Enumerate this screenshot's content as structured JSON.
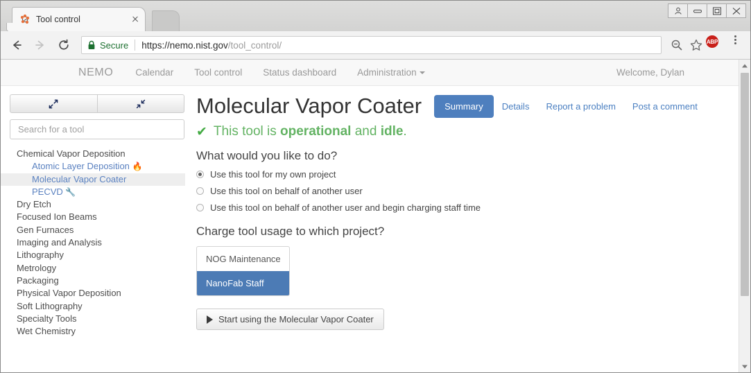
{
  "browser": {
    "tab": {
      "title": "Tool control",
      "favicon": "molecule-icon",
      "close": "close-icon"
    },
    "newtab_label": "",
    "window_controls": [
      {
        "name": "profile-icon"
      },
      {
        "name": "minimize-icon"
      },
      {
        "name": "maximize-icon"
      },
      {
        "name": "close-window-icon"
      }
    ],
    "nav": {
      "back": "back-icon",
      "forward": "forward-icon",
      "reload": "reload-icon"
    },
    "omnibox": {
      "lock": "lock-icon",
      "secure_label": "Secure",
      "url_domain": "https://nemo.nist.gov",
      "url_path": "/tool_control/"
    },
    "toolbar_icons": {
      "zoom": "zoom-out-icon",
      "bookmark": "star-icon",
      "adblock_label": "ABP",
      "menu": "kebab-menu-icon"
    }
  },
  "site": {
    "brand": "NEMO",
    "nav_links": [
      {
        "label": "Calendar",
        "has_caret": false
      },
      {
        "label": "Tool control",
        "has_caret": false
      },
      {
        "label": "Status dashboard",
        "has_caret": false
      },
      {
        "label": "Administration",
        "has_caret": true
      }
    ],
    "welcome": "Welcome, Dylan"
  },
  "sidebar": {
    "expand_button": "expand-arrows-icon",
    "collapse_button": "collapse-arrows-icon",
    "search": {
      "placeholder": "Search for a tool",
      "value": ""
    },
    "tree": [
      {
        "type": "category",
        "label": "Chemical Vapor Deposition"
      },
      {
        "type": "tool",
        "label": "Atomic Layer Deposition",
        "emoji": "🔥",
        "selected": false
      },
      {
        "type": "tool",
        "label": "Molecular Vapor Coater",
        "emoji": "",
        "selected": true
      },
      {
        "type": "tool",
        "label": "PECVD",
        "emoji": "🔧",
        "selected": false
      },
      {
        "type": "category",
        "label": "Dry Etch"
      },
      {
        "type": "category",
        "label": "Focused Ion Beams"
      },
      {
        "type": "category",
        "label": "Gen Furnaces"
      },
      {
        "type": "category",
        "label": "Imaging and Analysis"
      },
      {
        "type": "category",
        "label": "Lithography"
      },
      {
        "type": "category",
        "label": "Metrology"
      },
      {
        "type": "category",
        "label": "Packaging"
      },
      {
        "type": "category",
        "label": "Physical Vapor Deposition"
      },
      {
        "type": "category",
        "label": "Soft Lithography"
      },
      {
        "type": "category",
        "label": "Specialty Tools"
      },
      {
        "type": "category",
        "label": "Wet Chemistry"
      }
    ]
  },
  "main": {
    "title": "Molecular Vapor Coater",
    "tabs": [
      {
        "label": "Summary",
        "active": true
      },
      {
        "label": "Details",
        "active": false
      },
      {
        "label": "Report a problem",
        "active": false
      },
      {
        "label": "Post a comment",
        "active": false
      }
    ],
    "status": {
      "check": "✔",
      "prefix": "This tool is",
      "state": "operational",
      "middle": "and",
      "activity": "idle",
      "suffix": "."
    },
    "question1": "What would you like to do?",
    "options": [
      {
        "label": "Use this tool for my own project",
        "selected": true
      },
      {
        "label": "Use this tool on behalf of another user",
        "selected": false
      },
      {
        "label": "Use this tool on behalf of another user and begin charging staff time",
        "selected": false
      }
    ],
    "question2": "Charge tool usage to which project?",
    "projects": [
      {
        "label": "NOG Maintenance",
        "selected": false
      },
      {
        "label": "NanoFab Staff",
        "selected": true
      }
    ],
    "start_button": {
      "icon": "play-icon",
      "label": "Start using the Molecular Vapor Coater"
    }
  },
  "colors": {
    "accent_blue": "#4e7fbe",
    "link_blue": "#4a7fc1",
    "status_green": "#63b363",
    "selected_row": "#eeeeee",
    "secure_green": "#1d7030"
  }
}
